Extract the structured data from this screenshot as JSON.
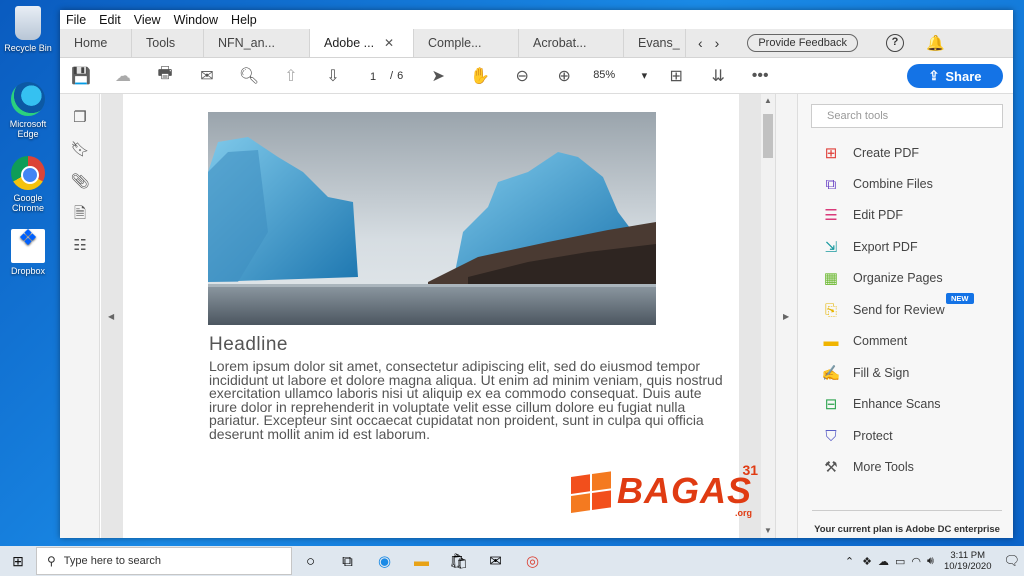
{
  "desktop": {
    "icons": [
      {
        "label": "Recycle Bin"
      },
      {
        "label": "Microsoft Edge"
      },
      {
        "label": "Google Chrome"
      },
      {
        "label": "Dropbox"
      }
    ]
  },
  "menubar": {
    "items": [
      "File",
      "Edit",
      "View",
      "Window",
      "Help"
    ]
  },
  "tabs": {
    "items": [
      {
        "label": "Home"
      },
      {
        "label": "Tools"
      },
      {
        "label": "NFN_an..."
      },
      {
        "label": "Adobe ..."
      },
      {
        "label": "Comple..."
      },
      {
        "label": "Acrobat..."
      },
      {
        "label": "Evans_"
      }
    ],
    "close_glyph": "✕",
    "feedback_label": "Provide Feedback",
    "help_glyph": "?"
  },
  "toolbar": {
    "current_page": "1",
    "page_separator": "/",
    "total_pages": "6",
    "zoom": "85%",
    "share_label": "Share"
  },
  "document": {
    "headline": "Headline",
    "body": "Lorem ipsum dolor sit amet, consectetur adipiscing elit, sed do eiusmod tempor incididunt ut labore et dolore magna aliqua. Ut enim ad minim veniam, quis nostrud exercitation ullamco laboris nisi ut aliquip ex ea commodo consequat. Duis aute irure dolor in reprehenderit in voluptate velit esse cillum dolore eu fugiat nulla pariatur. Excepteur sint occaecat cupidatat non proident, sunt in culpa qui officia deserunt mollit anim id est laborum.",
    "watermark_word": "BAGAS",
    "watermark_num": "31",
    "watermark_org": ".org"
  },
  "tools": {
    "search_placeholder": "Search tools",
    "items": [
      {
        "label": "Create PDF",
        "icon": "create-pdf-icon",
        "color": "#e0403a"
      },
      {
        "label": "Combine Files",
        "icon": "combine-files-icon",
        "color": "#6b45c6"
      },
      {
        "label": "Edit PDF",
        "icon": "edit-pdf-icon",
        "color": "#d93a7a"
      },
      {
        "label": "Export PDF",
        "icon": "export-pdf-icon",
        "color": "#1b9aa0"
      },
      {
        "label": "Organize Pages",
        "icon": "organize-pages-icon",
        "color": "#6ab82e"
      },
      {
        "label": "Send for Review",
        "icon": "send-review-icon",
        "color": "#e6b400"
      },
      {
        "label": "Comment",
        "icon": "comment-icon",
        "color": "#f0b400"
      },
      {
        "label": "Fill & Sign",
        "icon": "fill-sign-icon",
        "color": "#8a4ed1"
      },
      {
        "label": "Enhance Scans",
        "icon": "enhance-scans-icon",
        "color": "#2ea44f"
      },
      {
        "label": "Protect",
        "icon": "protect-icon",
        "color": "#5b5fc7"
      },
      {
        "label": "More Tools",
        "icon": "more-tools-icon",
        "color": "#555555"
      }
    ],
    "new_badge": "NEW",
    "plan_text": "Your current plan is Adobe DC enterprise"
  },
  "taskbar": {
    "search_placeholder": "Type here to search",
    "time": "3:11 PM",
    "date": "10/19/2020"
  }
}
